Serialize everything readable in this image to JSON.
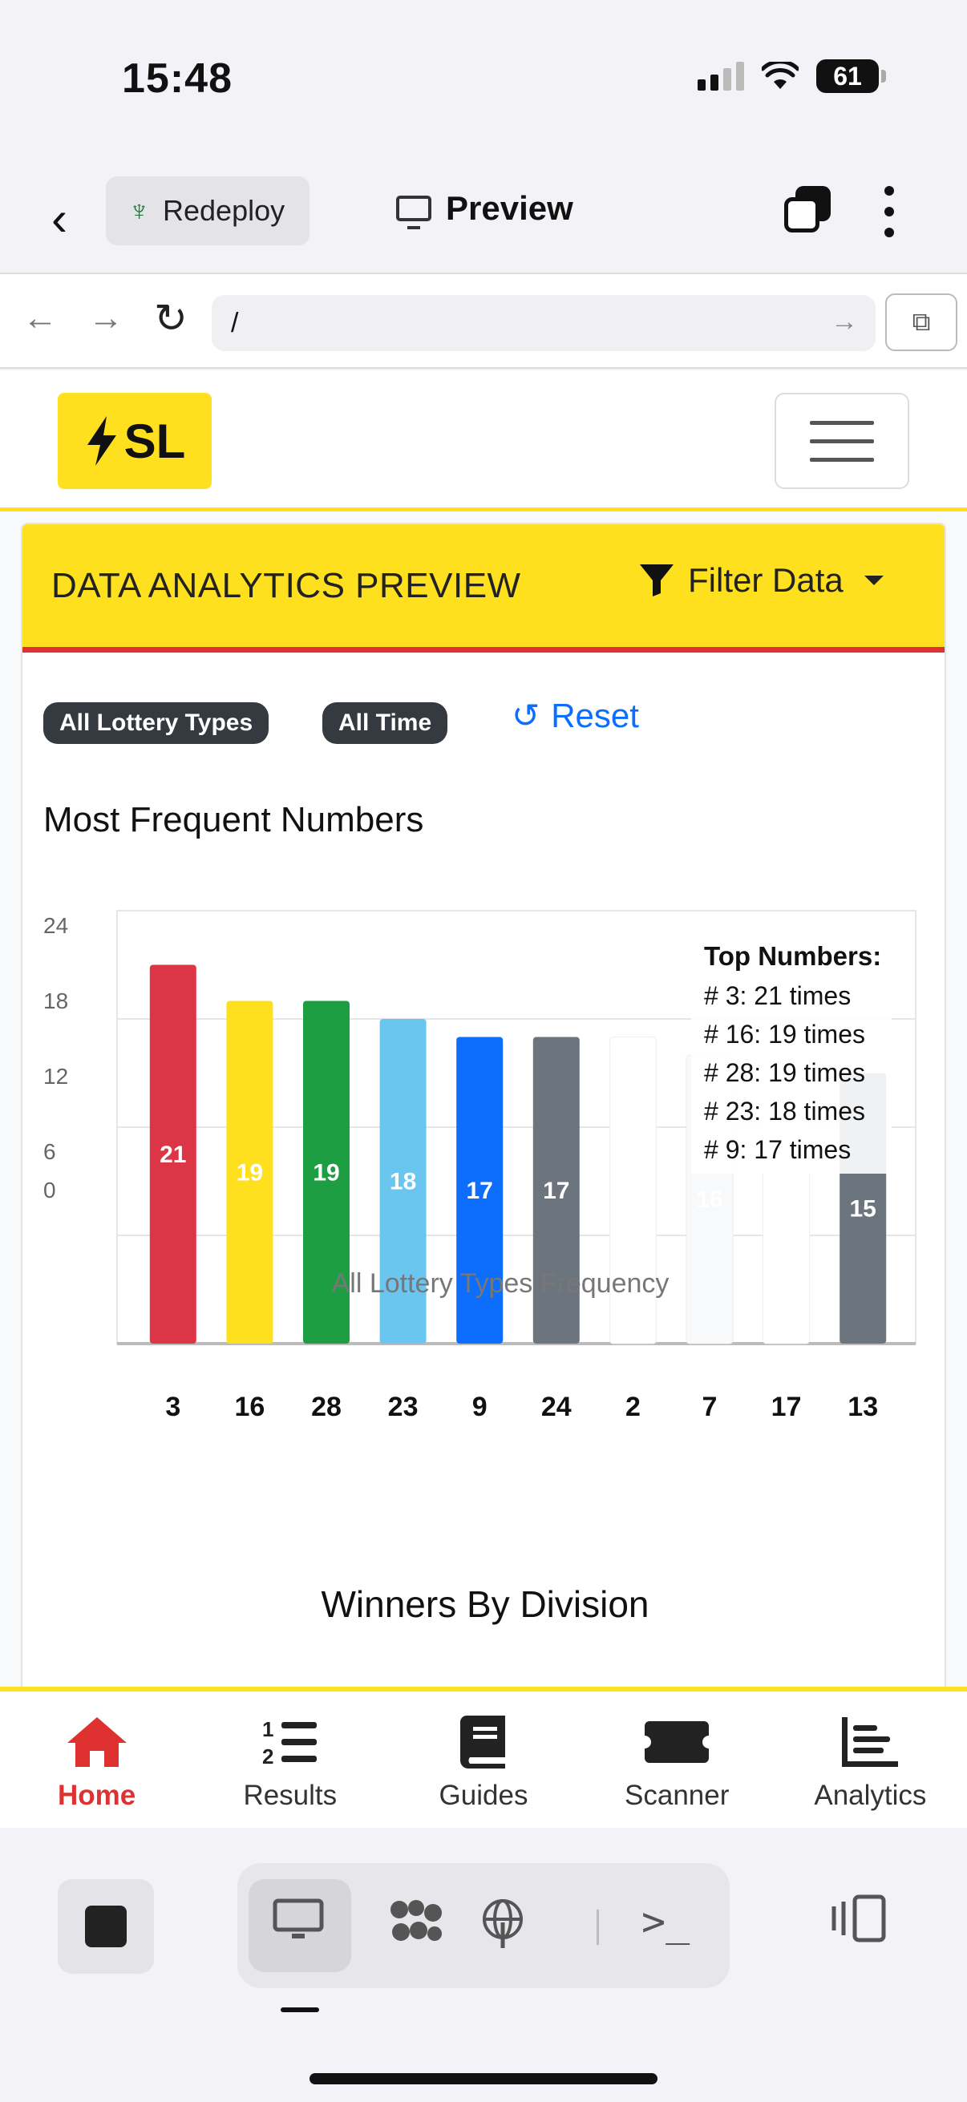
{
  "status_bar": {
    "time": "15:48",
    "battery": "61"
  },
  "app_bar": {
    "redeploy_label": "Redeploy",
    "preview_label": "Preview"
  },
  "browser": {
    "url": "/"
  },
  "site": {
    "logo_text": "SL"
  },
  "card": {
    "title": "DATA ANALYTICS PREVIEW",
    "filter_label": "Filter Data",
    "badges": [
      "All Lottery Types",
      "All Time"
    ],
    "reset_label": "Reset",
    "winners_title": "Winners By Division"
  },
  "chart_data": {
    "type": "bar",
    "title": "Most Frequent Numbers",
    "categories": [
      "3",
      "16",
      "28",
      "23",
      "9",
      "24",
      "2",
      "7",
      "17",
      "13"
    ],
    "values": [
      21,
      19,
      19,
      18,
      17,
      17,
      17,
      16,
      17,
      15
    ],
    "bar_colors": [
      "#dc3545",
      "#ffe01f",
      "#1e9e42",
      "#6ac6ef",
      "#0d6efd",
      "#6c757d",
      "#ffffff",
      "#f8f9fa",
      "#ffffff",
      "#6c757d"
    ],
    "y_ticks": [
      "24",
      "18",
      "12",
      "6",
      "0"
    ],
    "ylim": [
      0,
      24
    ],
    "legend_text": "All Lottery Types Frequency",
    "annotation": {
      "title": "Top Numbers:",
      "lines": [
        "# 3: 21 times",
        "# 16: 19 times",
        "# 28: 19 times",
        "# 23: 18 times",
        "# 9: 17 times"
      ]
    },
    "grid": true
  },
  "tab_bar": {
    "items": [
      {
        "label": "Home",
        "icon": "home-icon",
        "active": true
      },
      {
        "label": "Results",
        "icon": "numbered-list-icon",
        "active": false
      },
      {
        "label": "Guides",
        "icon": "book-icon",
        "active": false
      },
      {
        "label": "Scanner",
        "icon": "ticket-icon",
        "active": false
      },
      {
        "label": "Analytics",
        "icon": "bar-chart-icon",
        "active": false
      }
    ]
  },
  "colors": {
    "brand_yellow": "#ffe01f",
    "brand_red": "#e03131",
    "link_blue": "#0d6efd"
  }
}
